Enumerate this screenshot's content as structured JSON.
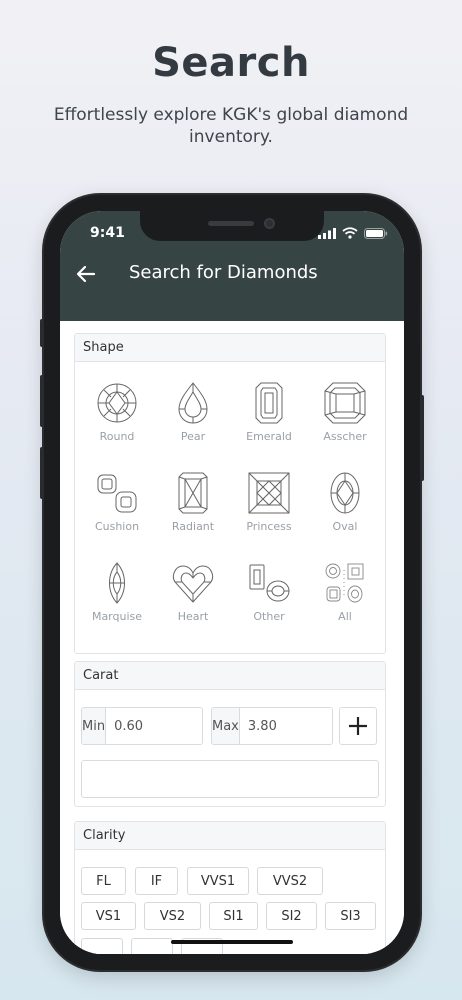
{
  "promo": {
    "title": "Search",
    "subtitle": "Effortlessly explore KGK's global diamond inventory."
  },
  "status_bar": {
    "time": "9:41"
  },
  "appbar": {
    "title": "Search for Diamonds"
  },
  "shape_section": {
    "header": "Shape",
    "items": [
      {
        "label": "Round",
        "icon": "round-diamond-icon"
      },
      {
        "label": "Pear",
        "icon": "pear-diamond-icon"
      },
      {
        "label": "Emerald",
        "icon": "emerald-diamond-icon"
      },
      {
        "label": "Asscher",
        "icon": "asscher-diamond-icon"
      },
      {
        "label": "Cushion",
        "icon": "cushion-diamond-icon"
      },
      {
        "label": "Radiant",
        "icon": "radiant-diamond-icon"
      },
      {
        "label": "Princess",
        "icon": "princess-diamond-icon"
      },
      {
        "label": "Oval",
        "icon": "oval-diamond-icon"
      },
      {
        "label": "Marquise",
        "icon": "marquise-diamond-icon"
      },
      {
        "label": "Heart",
        "icon": "heart-diamond-icon"
      },
      {
        "label": "Other",
        "icon": "other-diamond-icon"
      },
      {
        "label": "All",
        "icon": "all-diamonds-icon"
      }
    ]
  },
  "carat_section": {
    "header": "Carat",
    "min_label": "Min",
    "min_value": "0.60",
    "max_label": "Max",
    "max_value": "3.80",
    "add_label": "+"
  },
  "clarity_section": {
    "header": "Clarity",
    "chips": [
      "FL",
      "IF",
      "VVS1",
      "VVS2",
      "VS1",
      "VS2",
      "SI1",
      "SI2",
      "SI3"
    ]
  },
  "colors": {
    "appbar": "#364543",
    "frame": "#1b1c1e"
  }
}
